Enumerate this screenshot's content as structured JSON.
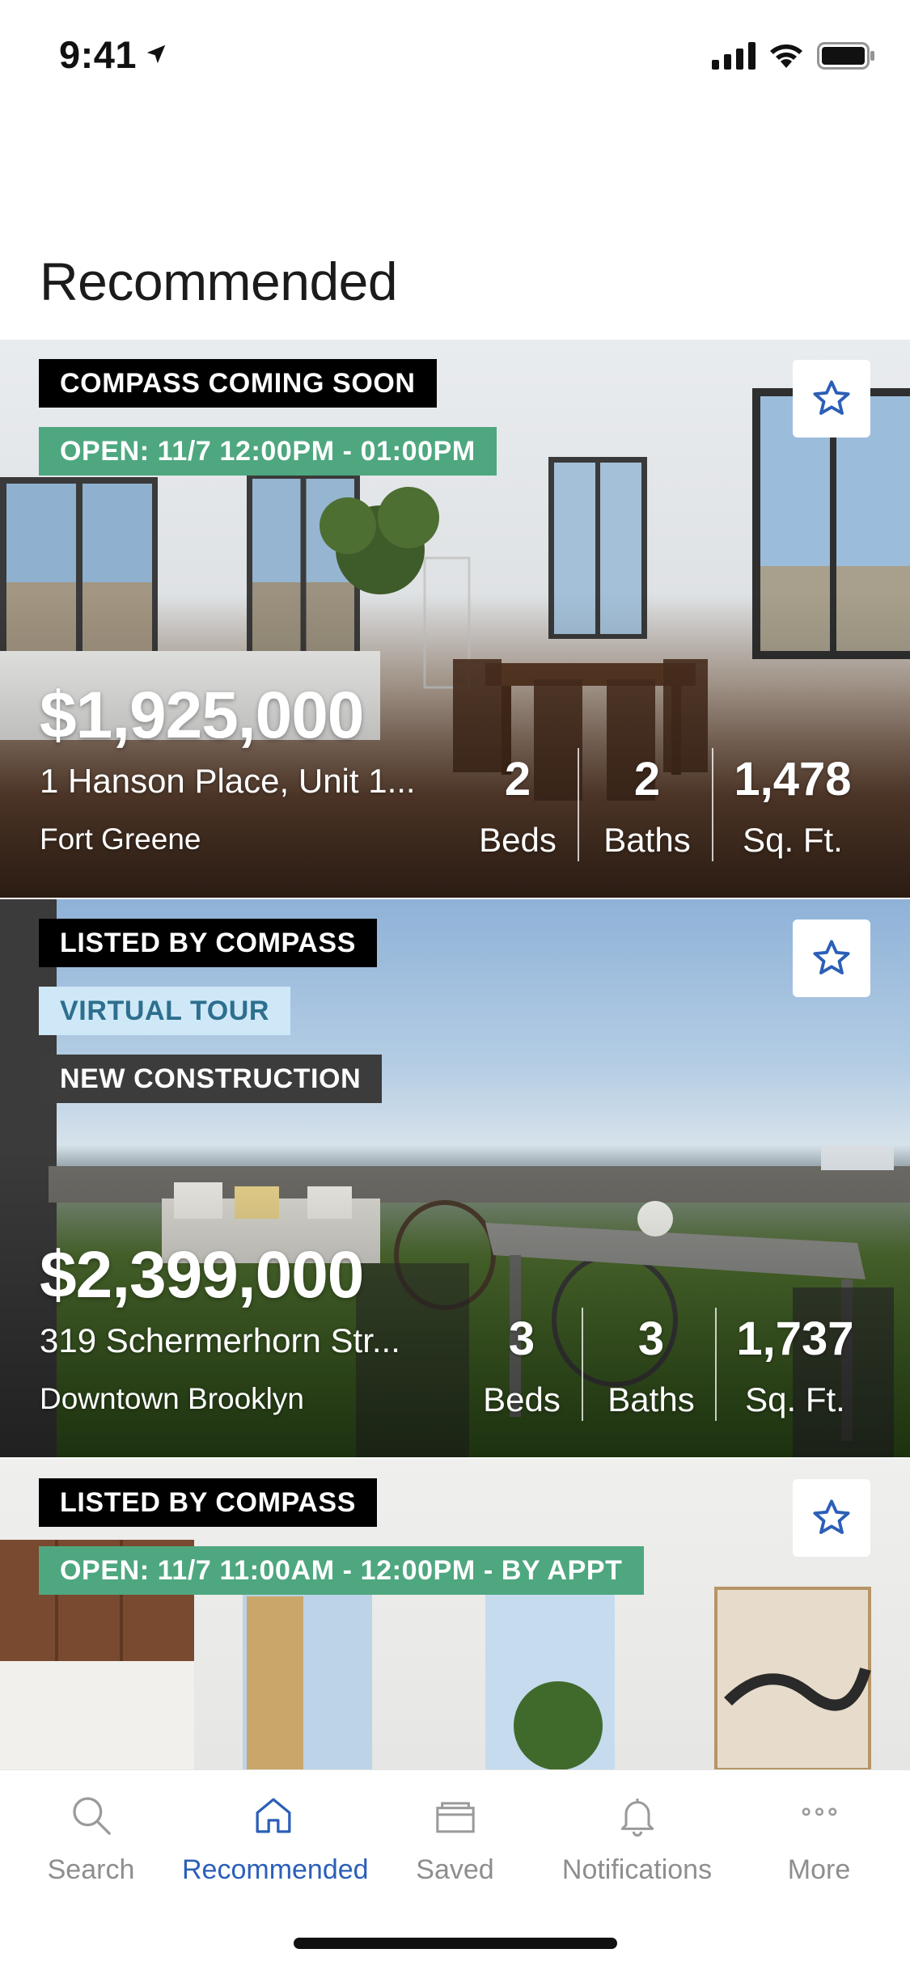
{
  "status_bar": {
    "time": "9:41"
  },
  "page": {
    "title": "Recommended"
  },
  "listings": [
    {
      "tags": [
        "COMPASS COMING SOON",
        "OPEN: 11/7 12:00PM - 01:00PM"
      ],
      "price": "$1,925,000",
      "address": "1 Hanson Place, Unit 1...",
      "neighborhood": "Fort Greene",
      "beds_value": "2",
      "beds_label": "Beds",
      "baths_value": "2",
      "baths_label": "Baths",
      "sqft_value": "1,478",
      "sqft_label": "Sq. Ft."
    },
    {
      "tags": [
        "LISTED BY COMPASS",
        "VIRTUAL TOUR",
        "NEW CONSTRUCTION"
      ],
      "price": "$2,399,000",
      "address": "319 Schermerhorn Str...",
      "neighborhood": "Downtown Brooklyn",
      "beds_value": "3",
      "beds_label": "Beds",
      "baths_value": "3",
      "baths_label": "Baths",
      "sqft_value": "1,737",
      "sqft_label": "Sq. Ft."
    },
    {
      "tags": [
        "LISTED BY COMPASS",
        "OPEN: 11/7 11:00AM - 12:00PM - BY APPT"
      ]
    }
  ],
  "tab_bar": {
    "items": [
      {
        "label": "Search",
        "icon": "search-icon"
      },
      {
        "label": "Recommended",
        "icon": "home-icon",
        "active": true
      },
      {
        "label": "Saved",
        "icon": "folder-icon"
      },
      {
        "label": "Notifications",
        "icon": "bell-icon"
      },
      {
        "label": "More",
        "icon": "more-icon"
      }
    ]
  },
  "colors": {
    "accent_blue": "#2b5fb8",
    "tag_black": "#000000",
    "tag_green": "#4ea77f",
    "tag_virtual_tour_bg": "#cfe8f7",
    "tag_virtual_tour_text": "#2d6f8e",
    "tag_gray": "#3c3c3c",
    "tab_inactive": "#8e8e8e"
  }
}
